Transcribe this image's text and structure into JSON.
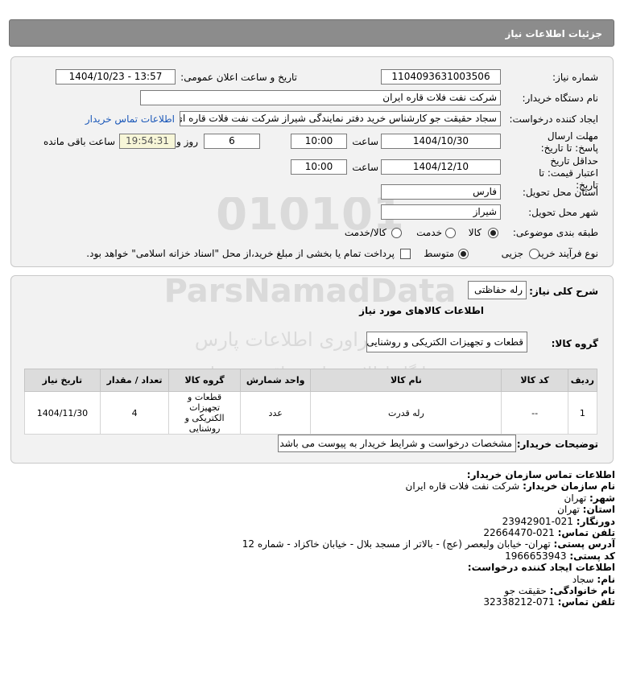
{
  "header": {
    "title": "جزئیات اطلاعات نیاز"
  },
  "form": {
    "need_number": {
      "label": "شماره نیاز:",
      "value": "1104093631003506"
    },
    "announce_datetime": {
      "label": "تاریخ و ساعت اعلان عمومی:",
      "value": "1404/10/23 - 13:57"
    },
    "buyer_org": {
      "label": "نام دستگاه خریدار:",
      "value": "شرکت نفت فلات قاره ایران"
    },
    "requester": {
      "label": "ایجاد کننده درخواست:",
      "value": "سجاد حقیقت جو کارشناس خرید دفتر نمایندگی شیراز شرکت نفت فلات قاره ای",
      "link": "اطلاعات تماس خریدار"
    },
    "reply_deadline": {
      "label": "مهلت ارسال پاسخ: تا تاریخ:",
      "date": "1404/10/30",
      "time_label": "ساعت",
      "time": "10:00",
      "days": "6",
      "days_label": "روز و",
      "remaining": "19:54:31",
      "remaining_label": "ساعت باقی مانده"
    },
    "price_validity": {
      "label": "حداقل تاریخ اعتبار قیمت: تا تاریخ:",
      "date": "1404/12/10",
      "time_label": "ساعت",
      "time": "10:00"
    },
    "delivery_province": {
      "label": "استان محل تحویل:",
      "value": "فارس"
    },
    "delivery_city": {
      "label": "شهر محل تحویل:",
      "value": "شیراز"
    },
    "category": {
      "label": "طبقه بندی موضوعی:",
      "options": [
        "کالا",
        "خدمت",
        "کالا/خدمت"
      ],
      "selected": "کالا"
    },
    "purchase_process": {
      "label": "نوع فرآیند خرید :",
      "options": [
        "جزیی",
        "متوسط"
      ],
      "selected": "متوسط",
      "payment_note": "پرداخت تمام یا بخشی از مبلغ خرید،از محل \"اسناد خزانه اسلامی\" خواهد بود."
    }
  },
  "summary": {
    "general_desc_label": "شرح کلی نیاز:",
    "general_desc": "رله حفاظتی",
    "goods_info_title": "اطلاعات کالاهای مورد نیاز",
    "goods_group_label": "گروه کالا:",
    "goods_group": "قطعات و تجهیزات الکتریکی و روشنایی",
    "table": {
      "headers": [
        "ردیف",
        "کد کالا",
        "نام کالا",
        "واحد شمارش",
        "گروه کالا",
        "تعداد / مقدار",
        "تاریخ نیاز"
      ],
      "rows": [
        [
          "1",
          "--",
          "رله قدرت",
          "عدد",
          "قطعات و تجهیزات الکتریکی و روشنایی",
          "4",
          "1404/11/30"
        ]
      ]
    },
    "buyer_notes_label": "توضیحات خریدار:",
    "buyer_notes": "مشخصات درخواست و شرایط خریدار به پیوست می باشد"
  },
  "contact": {
    "title": "اطلاعات تماس سازمان خریدار:",
    "org_label": "نام سازمان خریدار:",
    "org": "شرکت نفت فلات قاره ایران",
    "city_label": "شهر:",
    "city": "تهران",
    "province_label": "استان:",
    "province": "تهران",
    "fax_label": "دورنگار:",
    "fax": "021-23942901",
    "phone_label": "تلفن تماس:",
    "phone": "021-22664470",
    "address_label": "آدرس پستی:",
    "address": "تهران- خیابان ولیعصر (عج) - بالاتر از مسجد بلال - خیابان خاکزاد - شماره 12",
    "postal_label": "کد پستی:",
    "postal": "1966653943",
    "creator_title": "اطلاعات ایجاد کننده درخواست:",
    "first_name_label": "نام:",
    "first_name": "سجاد",
    "last_name_label": "نام خانوادگی:",
    "last_name": "حقیقت جو",
    "creator_phone_label": "تلفن تماس:",
    "creator_phone": "071-32338212"
  },
  "watermark": {
    "digits": "010101",
    "brand": "ParsNamadData",
    "line1": "مرکز فراوری اطلاعات پارس",
    "line2": "پایگاه اطلاع رسانی مناقصه و مزایده",
    "phone": "۰۲۱-۸۸۳۴۹۶۷۰-۵"
  },
  "colors": {
    "header_bg": "#8c8c8c",
    "panel_bg": "#f2f2f2",
    "link": "#1a57b8"
  }
}
